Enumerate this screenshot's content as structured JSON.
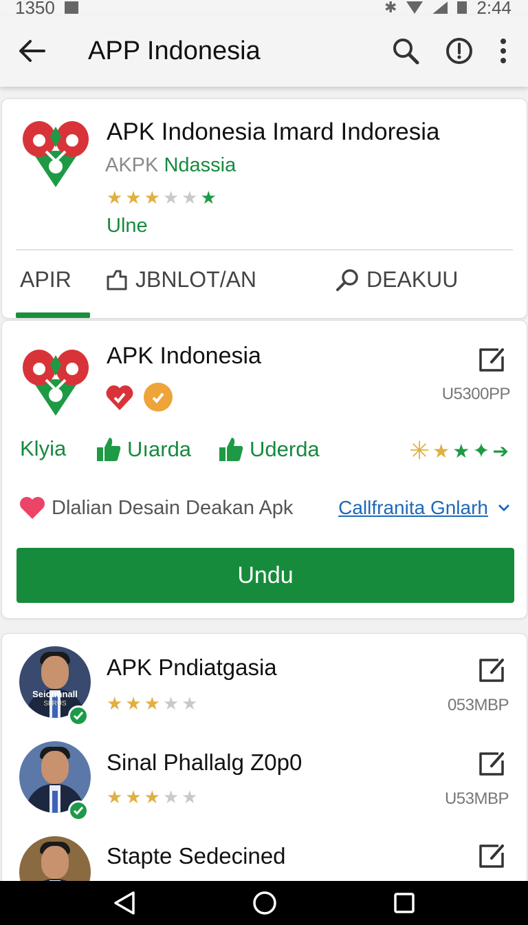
{
  "status_bar": {
    "time_left": "1350",
    "time_right": "2:44"
  },
  "app_bar": {
    "title": "APP Indonesia"
  },
  "featured": {
    "title": "APK Indonesia Imard Indoresia",
    "developer_prefix": "AKPK",
    "developer_name": "Ndassia",
    "rating": 3,
    "rating_max": 5,
    "status": "Ulne",
    "tabs": [
      {
        "label": "APIR",
        "icon": ""
      },
      {
        "label": "JBNLOT/AN",
        "icon": "folder-icon"
      },
      {
        "label": "DEAKUU",
        "icon": "search-icon"
      }
    ],
    "active_tab": 0
  },
  "detail": {
    "title": "APK Indonesia",
    "size": "U5300PP",
    "stats": [
      {
        "label": "Klyia",
        "icon": ""
      },
      {
        "label": "Uıarda",
        "icon": "thumbs-up-icon"
      },
      {
        "label": "Uderda",
        "icon": "thumbs-up-icon"
      }
    ],
    "favorite_text": "Dlalian Desain Deakan Apk",
    "category_link": "Callfranita Gnlarh",
    "download_label": "Undu"
  },
  "list": [
    {
      "title": "APK Pndiatgasia",
      "size": "053MBP",
      "rating": 3,
      "avatar_caption": "Seiounnall",
      "avatar_subcaption": "SLRUS"
    },
    {
      "title": "Sinal Phallalg Z0p0",
      "size": "U53MBP",
      "rating": 3
    },
    {
      "title": "Stapte Sedecined",
      "size": "",
      "rating": 0
    }
  ],
  "colors": {
    "accent_green": "#178b3c",
    "link_blue": "#1d68b8",
    "star_gold": "#e0b043",
    "star_grey": "#c9c9c9"
  }
}
